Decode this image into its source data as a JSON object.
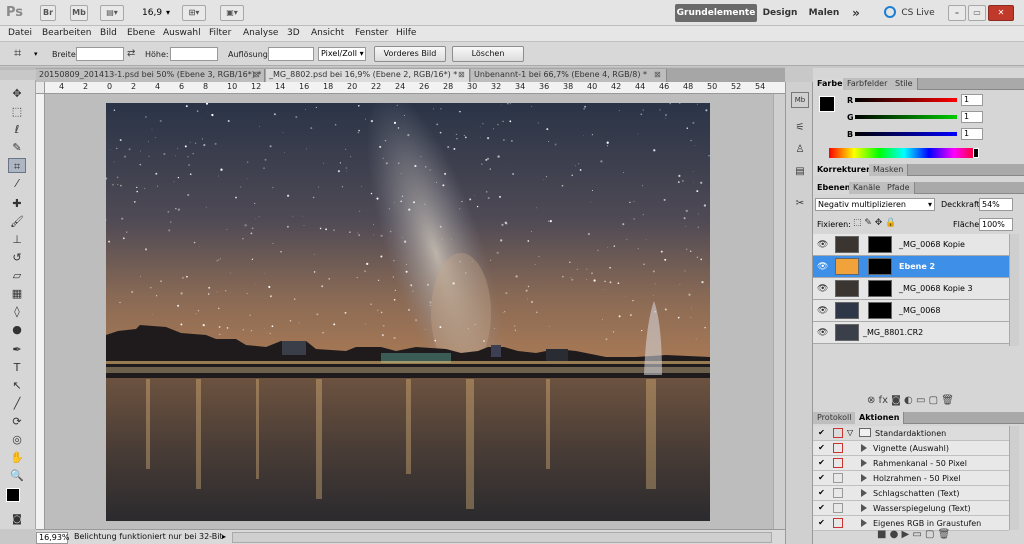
{
  "app": {
    "logo": "Ps"
  },
  "top_toolbar": {
    "br_label": "Br",
    "mb_label": "Mb",
    "zoom_value": "16,9"
  },
  "workspaces": {
    "grund": "Grundelemente",
    "design": "Design",
    "malen": "Malen",
    "more": "»",
    "cslive": "CS Live"
  },
  "menu": [
    "Datei",
    "Bearbeiten",
    "Bild",
    "Ebene",
    "Auswahl",
    "Filter",
    "Analyse",
    "3D",
    "Ansicht",
    "Fenster",
    "Hilfe"
  ],
  "options": {
    "breite_label": "Breite:",
    "hoehe_label": "Höhe:",
    "aufloesung_label": "Auflösung:",
    "unit_select": "Pixel/Zoll",
    "vorderes_bild": "Vorderes Bild",
    "loeschen": "Löschen"
  },
  "doc_tabs": [
    {
      "label": "20150809_201413-1.psd bei 50% (Ebene 3, RGB/16*) *"
    },
    {
      "label": "_MG_8802.psd bei 16,9% (Ebene 2, RGB/16*) *"
    },
    {
      "label": "Unbenannt-1 bei 66,7% (Ebene 4, RGB/8) *"
    }
  ],
  "ruler_labels": [
    "4",
    "2",
    "0",
    "2",
    "4",
    "6",
    "8",
    "10",
    "12",
    "14",
    "16",
    "18",
    "20",
    "22",
    "24",
    "26",
    "28",
    "30",
    "32",
    "34",
    "36",
    "38",
    "40",
    "42",
    "44",
    "46",
    "48",
    "50",
    "52",
    "54"
  ],
  "status": {
    "zoom": "16,93%",
    "info": "Belichtung funktioniert nur bei 32-Bit"
  },
  "color_panel": {
    "tabs": [
      "Farbe",
      "Farbfelder",
      "Stile"
    ],
    "r_label": "R",
    "g_label": "G",
    "b_label": "B",
    "r_value": "1",
    "g_value": "1",
    "b_value": "1"
  },
  "adjust_tabs": [
    "Korrekturen",
    "Masken"
  ],
  "layers_panel": {
    "tabs": [
      "Ebenen",
      "Kanäle",
      "Pfade"
    ],
    "blend_mode": "Negativ multiplizieren",
    "opacity_label": "Deckkraft:",
    "opacity_value": "54%",
    "lock_label": "Fixieren:",
    "fill_label": "Fläche:",
    "fill_value": "100%",
    "layers": [
      {
        "name": "_MG_0068 Kopie",
        "selected": false,
        "thumb": "#3a3530"
      },
      {
        "name": "Ebene 2",
        "selected": true,
        "thumb": "#f2a23a"
      },
      {
        "name": "_MG_0068 Kopie 3",
        "selected": false,
        "thumb": "#3a3530"
      },
      {
        "name": "_MG_0068",
        "selected": false,
        "thumb": "#2d3748"
      },
      {
        "name": "_MG_8801.CR2",
        "selected": false,
        "thumb": "#3b3f4a"
      }
    ]
  },
  "actions_panel": {
    "tabs": [
      "Protokoll",
      "Aktionen"
    ],
    "set_name": "Standardaktionen",
    "items": [
      "Vignette (Auswahl)",
      "Rahmenkanal - 50 Pixel",
      "Holzrahmen - 50 Pixel",
      "Schlagschatten (Text)",
      "Wasserspiegelung (Text)",
      "Eigenes RGB in Graustufen"
    ]
  },
  "colors": {
    "selection": "#3d8fe8",
    "orange": "#f2a23a"
  }
}
